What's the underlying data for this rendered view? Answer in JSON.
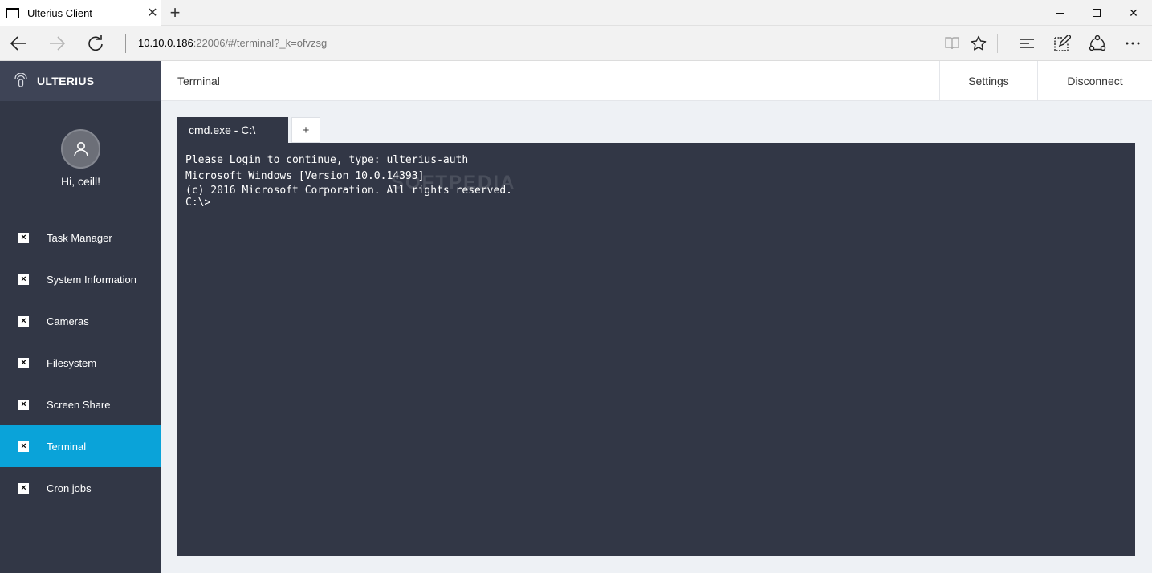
{
  "browser": {
    "tab_title": "Ulterius Client",
    "close_tab": "✕",
    "new_tab": "+",
    "close_window": "✕",
    "address_host": "10.10.0.186",
    "address_rest": ":22006/#/terminal?_k=ofvzsg",
    "icons": [
      "back-icon",
      "forward-icon",
      "refresh-icon",
      "reading-view-icon",
      "favorite-star-icon",
      "hub-icon",
      "web-note-icon",
      "share-icon",
      "more-icon"
    ]
  },
  "app": {
    "brand": "ULTERIUS",
    "greeting": "Hi, ceill!",
    "page_title": "Terminal",
    "settings_label": "Settings",
    "disconnect_label": "Disconnect",
    "active_color": "#0aa3d9",
    "sidebar_color": "#323746"
  },
  "sidebar": {
    "items": [
      {
        "label": "Task Manager"
      },
      {
        "label": "System Information"
      },
      {
        "label": "Cameras"
      },
      {
        "label": "Filesystem"
      },
      {
        "label": "Screen Share"
      },
      {
        "label": "Terminal",
        "active": true
      },
      {
        "label": "Cron jobs"
      }
    ]
  },
  "terminal": {
    "tab_label": "cmd.exe - C:\\",
    "add_tab": "+",
    "lines": [
      "Please Login to continue, type: ulterius-auth",
      "Microsoft Windows [Version 10.0.14393]",
      "(c) 2016 Microsoft Corporation. All rights reserved.",
      "C:\\>"
    ],
    "watermark": "SOFTPEDIA"
  }
}
